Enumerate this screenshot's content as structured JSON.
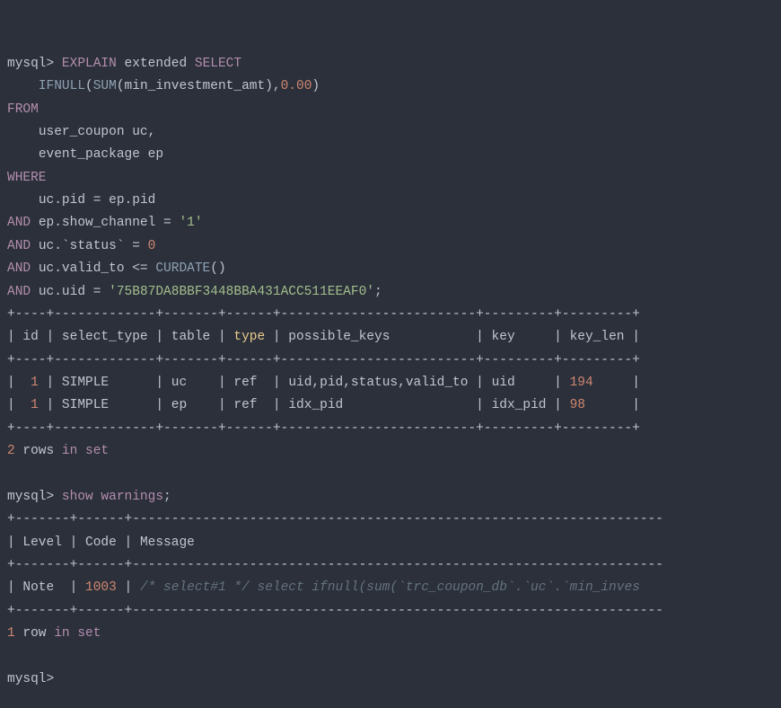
{
  "query": {
    "prompt": "mysql>",
    "explain": "EXPLAIN",
    "extended": "extended",
    "select": "SELECT",
    "ifnull": "IFNULL",
    "sum": "SUM",
    "col": "min_investment_amt",
    "default_val": "0.00",
    "from": "FROM",
    "t1": "user_coupon uc",
    "t2": "event_package ep",
    "where": "WHERE",
    "cond1_lhs": "uc.pid",
    "cond1_rhs": "ep.pid",
    "and": "AND",
    "cond2_lhs": "ep.show_channel",
    "cond2_rhs": "'1'",
    "cond3_lhs": "uc.`status`",
    "cond3_rhs": "0",
    "cond4_lhs": "uc.valid_to",
    "curdate": "CURDATE",
    "cond5_lhs": "uc.uid",
    "cond5_rhs": "'75B87DA8BBF3448BBA431ACC511EEAF0'"
  },
  "explain_table": {
    "sep": "+----+-------------+-------+------+-------------------------+---------+---------+",
    "hdr_id": "id",
    "hdr_select_type": "select_type",
    "hdr_table": "table",
    "hdr_type": "type",
    "hdr_possible_keys": "possible_keys",
    "hdr_key": "key",
    "hdr_key_len": "key_len",
    "rows": [
      {
        "id": "1",
        "select_type": "SIMPLE",
        "table": "uc",
        "type": "ref",
        "possible_keys": "uid,pid,status,valid_to",
        "key": "uid",
        "key_len": "194"
      },
      {
        "id": "1",
        "select_type": "SIMPLE",
        "table": "ep",
        "type": "ref",
        "possible_keys": "idx_pid",
        "key": "idx_pid",
        "key_len": "98"
      }
    ],
    "footer_count": "2",
    "rows_word": "rows",
    "in": "in",
    "set": "set"
  },
  "warnings": {
    "cmd": "show warnings",
    "sep": "+-------+------+--------------------------------------------------------------------",
    "hdr_level": "Level",
    "hdr_code": "Code",
    "hdr_msg": "Message",
    "row": {
      "level": "Note",
      "code": "1003",
      "msg_prefix": "/* select",
      "msg_mid": "#1 */ select ifnull(sum(`trc_coupon_db`.`uc`.`min_inves"
    },
    "footer_count": "1",
    "row_word": "row",
    "in": "in",
    "set": "set"
  },
  "final_prompt": "mysql>"
}
